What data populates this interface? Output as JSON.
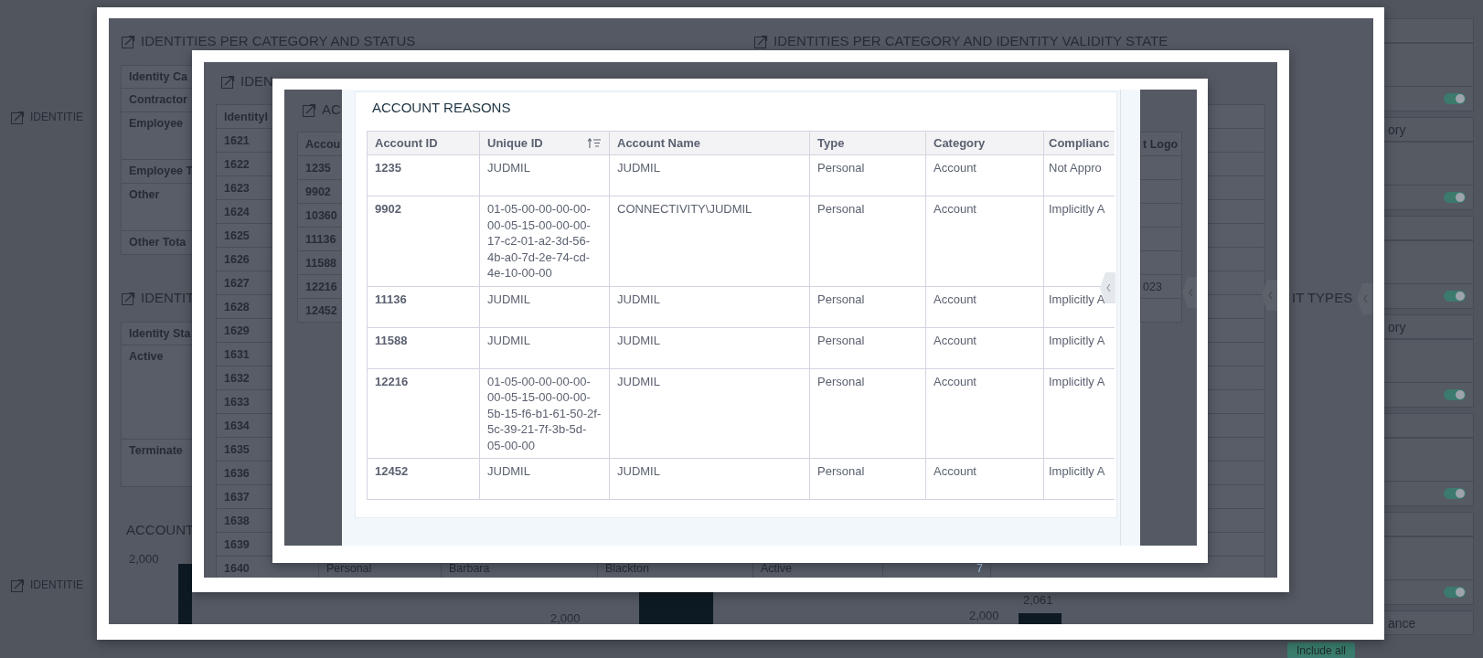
{
  "page": {
    "section_titles": [
      "IDENTITIE",
      "IDENTITIE"
    ],
    "filters": [
      {
        "kind": "toggle",
        "on": true
      },
      {
        "kind": "toggle",
        "label": "ory",
        "on": true
      },
      {
        "kind": "toggle",
        "on": true
      },
      {
        "kind": "toggle",
        "label": "ory",
        "on": true
      },
      {
        "kind": "toggle",
        "on": true
      },
      {
        "kind": "toggle",
        "on": true
      },
      {
        "kind": "field",
        "label": "ance"
      }
    ],
    "include_button": "Include all"
  },
  "dialog_1": {
    "titles": [
      "IDENTITIES PER CATEGORY AND STATUS",
      "IDENTITIES PER CATEGORY AND IDENTITY VALIDITY STATE"
    ],
    "category_table": {
      "header": "Identity Ca",
      "rows": [
        {
          "label": "Contractor",
          "kind": "row"
        },
        {
          "label": "Employee",
          "kind": "group"
        },
        {
          "label": "Employee T",
          "kind": "row"
        },
        {
          "label": "Other",
          "kind": "group"
        },
        {
          "label": "Other Tota",
          "kind": "row"
        }
      ]
    },
    "status_title": "IDENTIT",
    "status_table": {
      "header": "Identity Sta",
      "rows": [
        {
          "label": "Active",
          "kind": "large"
        },
        {
          "label": "Terminate",
          "kind": "group"
        }
      ]
    },
    "chart_title": "ACCOUNT",
    "left_axis_label": "2,000",
    "middle_axis_label": "2,000",
    "right_axis_label": "2,000",
    "bar_label": "2,061",
    "side_title": "IT TYPES"
  },
  "dialog_2": {
    "title": "IDEN",
    "table": {
      "header": "IdentityI",
      "rows": [
        {
          "id": "1621"
        },
        {
          "id": "1622"
        },
        {
          "id": "1623"
        },
        {
          "id": "1624"
        },
        {
          "id": "1625"
        },
        {
          "id": "1626"
        },
        {
          "id": "1627"
        },
        {
          "id": "1628"
        },
        {
          "id": "1629"
        },
        {
          "id": "1631"
        },
        {
          "id": "1632"
        },
        {
          "id": "1633"
        },
        {
          "id": "1634"
        },
        {
          "id": "1635"
        },
        {
          "id": "1636"
        },
        {
          "id": "1637"
        },
        {
          "id": "1638"
        },
        {
          "id": "1639"
        },
        {
          "id": "1640",
          "cells": [
            "Personal",
            "Barbara",
            "Blackton",
            "Active",
            "7"
          ]
        }
      ]
    }
  },
  "dialog_3": {
    "title": "AC",
    "table": {
      "first_column": "Accou",
      "last_column": "t Logo",
      "rows": [
        {
          "id": "1235"
        },
        {
          "id": "9902"
        },
        {
          "id": "10360"
        },
        {
          "id": "11136"
        },
        {
          "id": "11588"
        },
        {
          "id": "12216",
          "last": "023"
        },
        {
          "id": "12452"
        }
      ]
    }
  },
  "account_reasons": {
    "title": "ACCOUNT REASONS",
    "columns": [
      {
        "label": "Account ID",
        "sorted": false
      },
      {
        "label": "Unique ID",
        "sorted": true
      },
      {
        "label": "Account Name",
        "sorted": false
      },
      {
        "label": "Type",
        "sorted": false
      },
      {
        "label": "Category",
        "sorted": false
      },
      {
        "label": "Complianc",
        "sorted": false
      }
    ],
    "rows": [
      [
        "1235",
        "JUDMIL",
        "JUDMIL",
        "Personal",
        "Account",
        "Not Appro"
      ],
      [
        "9902",
        "01-05-00-00-00-00-00-05-15-00-00-00-17-c2-01-a2-3d-56-4b-a0-7d-2e-74-cd-4e-10-00-00",
        "CONNECTIVITY\\JUDMIL",
        "Personal",
        "Account",
        "Implicitly A"
      ],
      [
        "11136",
        "JUDMIL",
        "JUDMIL",
        "Personal",
        "Account",
        "Implicitly A"
      ],
      [
        "11588",
        "JUDMIL",
        "JUDMIL",
        "Personal",
        "Account",
        "Implicitly A"
      ],
      [
        "12216",
        "01-05-00-00-00-00-00-05-15-00-00-00-5b-15-f6-b1-61-50-2f-5c-39-21-7f-3b-5d-05-00-00",
        "JUDMIL",
        "Personal",
        "Account",
        "Implicitly A"
      ],
      [
        "12452",
        "JUDMIL",
        "JUDMIL",
        "Personal",
        "Account",
        "Implicitly A"
      ]
    ]
  }
}
